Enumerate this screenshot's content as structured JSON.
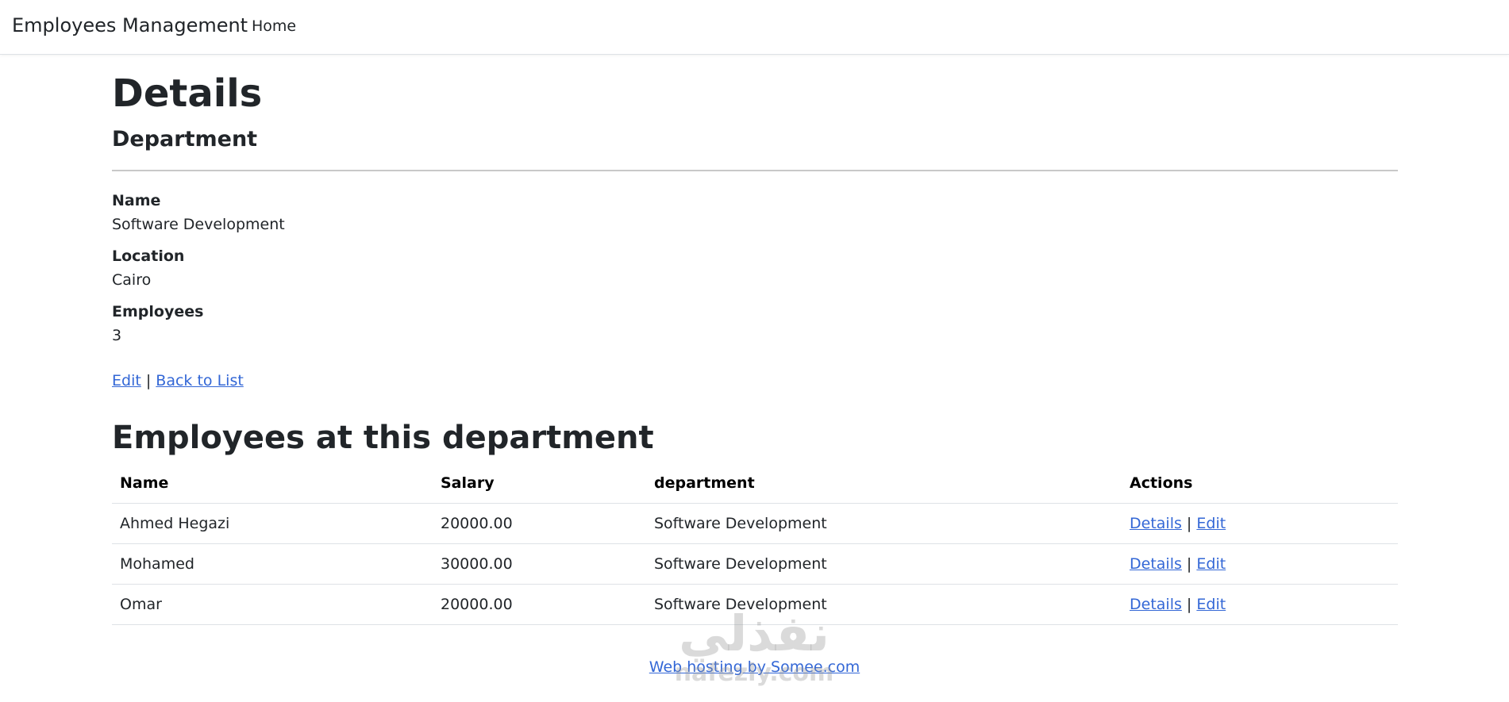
{
  "navbar": {
    "brand": "Employees Management",
    "links": [
      "Home"
    ]
  },
  "page": {
    "title": "Details",
    "subtitle": "Department"
  },
  "fields": [
    {
      "label": "Name",
      "value": "Software Development"
    },
    {
      "label": "Location",
      "value": "Cairo"
    },
    {
      "label": "Employees",
      "value": "3"
    }
  ],
  "actions": {
    "edit": "Edit",
    "separator": "|",
    "back": "Back to List"
  },
  "employees_section": {
    "heading": "Employees at this department",
    "columns": [
      "Name",
      "Salary",
      "department",
      "Actions"
    ],
    "rows": [
      {
        "name": "Ahmed Hegazi",
        "salary": "20000.00",
        "department": "Software Development",
        "details": "Details",
        "edit": "Edit"
      },
      {
        "name": "Mohamed",
        "salary": "30000.00",
        "department": "Software Development",
        "details": "Details",
        "edit": "Edit"
      },
      {
        "name": "Omar",
        "salary": "20000.00",
        "department": "Software Development",
        "details": "Details",
        "edit": "Edit"
      }
    ],
    "action_separator": "|"
  },
  "footer": {
    "link": "Web hosting by Somee.com"
  },
  "watermark": {
    "arabic": "نفذلي",
    "latin": "nafezly.com"
  },
  "colors": {
    "link": "#3367d6",
    "text": "#212529",
    "border": "#dee2e6"
  }
}
